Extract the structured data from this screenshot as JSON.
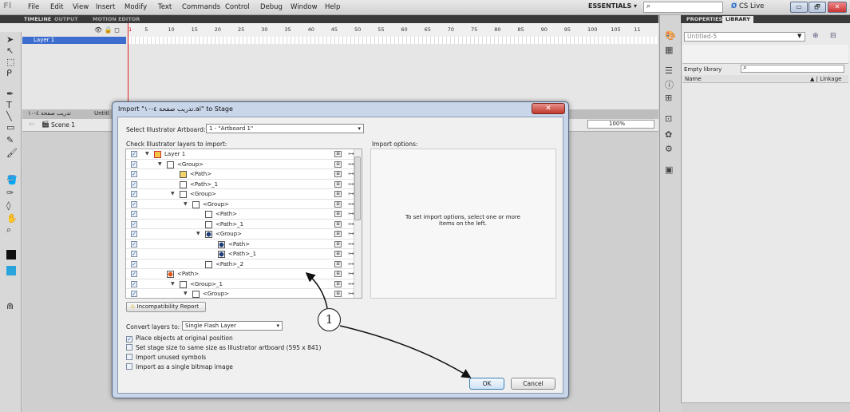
{
  "app": {
    "logo": "Fl",
    "menu": [
      "File",
      "Edit",
      "View",
      "Insert",
      "Modify",
      "Text",
      "Commands",
      "Control",
      "Debug",
      "Window",
      "Help"
    ],
    "workspace": "ESSENTIALS ▾",
    "cs_live": "CS Live",
    "window_buttons": [
      "▭",
      "🗗",
      "✕"
    ]
  },
  "timeline": {
    "tabs": [
      "TIMELINE",
      "OUTPUT",
      "MOTION EDITOR"
    ],
    "layer_name": "Layer 1",
    "frame_numbers": [
      "1",
      "5",
      "10",
      "15",
      "20",
      "25",
      "30",
      "35",
      "40",
      "45",
      "50",
      "55",
      "60",
      "65",
      "70",
      "75",
      "80",
      "85",
      "90",
      "95",
      "100",
      "105",
      "11"
    ]
  },
  "document": {
    "tab": "Untitl",
    "arabic_tab": "تدريب صفحة ٤-١٠",
    "scene": "Scene 1",
    "zoom": "100%"
  },
  "library": {
    "tabs": [
      "PROPERTIES",
      "LIBRARY"
    ],
    "document": "Untitled-5",
    "empty_label": "Empty library",
    "col_name": "Name",
    "col_linkage": "▲ | Linkage"
  },
  "dialog": {
    "title": "Import \"تدريب صفحة ٤-١٠.ai\" to Stage",
    "close": "✕",
    "artboard_label": "Select Illustrator Artboard:",
    "artboard_value": "1 - \"Artboard 1\"",
    "layers_label": "Check Illustrator layers to import:",
    "options_label": "Import options:",
    "options_hint": "To set import options, select one or more items on the left.",
    "incompat_button": "Incompatibility Report",
    "convert_label": "Convert layers to:",
    "convert_value": "Single Flash Layer",
    "options": [
      {
        "label": "Place objects at original position",
        "checked": "✓"
      },
      {
        "label": "Set stage size to same size as Illustrator artboard (595 x 841)",
        "checked": ""
      },
      {
        "label": "Import unused symbols",
        "checked": ""
      },
      {
        "label": "Import as a single bitmap image",
        "checked": ""
      }
    ],
    "ok": "OK",
    "cancel": "Cancel",
    "callout": "1",
    "tree": [
      {
        "label": "Layer 1",
        "twisty": "▼",
        "indent": 0,
        "icon": "layer"
      },
      {
        "label": "<Group>",
        "twisty": "▼",
        "indent": 1,
        "icon": "group"
      },
      {
        "label": "<Path>",
        "twisty": "",
        "indent": 2,
        "icon": "path-img"
      },
      {
        "label": "<Path>_1",
        "twisty": "",
        "indent": 2,
        "icon": "path-x"
      },
      {
        "label": "<Group>",
        "twisty": "▼",
        "indent": 2,
        "icon": "group"
      },
      {
        "label": "<Group>",
        "twisty": "▼",
        "indent": 3,
        "icon": "group"
      },
      {
        "label": "<Path>",
        "twisty": "",
        "indent": 4,
        "icon": "path-empty"
      },
      {
        "label": "<Path>_1",
        "twisty": "",
        "indent": 4,
        "icon": "path-empty"
      },
      {
        "label": "<Group>",
        "twisty": "▼",
        "indent": 4,
        "icon": "path-circle"
      },
      {
        "label": "<Path>",
        "twisty": "",
        "indent": 5,
        "icon": "path-circle"
      },
      {
        "label": "<Path>_1",
        "twisty": "",
        "indent": 5,
        "icon": "path-circle"
      },
      {
        "label": "<Path>_2",
        "twisty": "",
        "indent": 4,
        "icon": "path-empty"
      },
      {
        "label": "<Path>",
        "twisty": "",
        "indent": 1,
        "icon": "path-orange"
      },
      {
        "label": "<Group>_1",
        "twisty": "▼",
        "indent": 2,
        "icon": "group"
      },
      {
        "label": "<Group>",
        "twisty": "▼",
        "indent": 3,
        "icon": "group"
      }
    ]
  }
}
